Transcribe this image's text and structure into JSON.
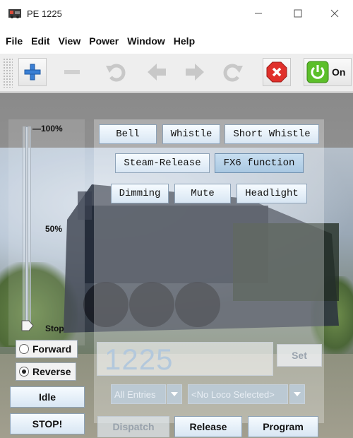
{
  "window": {
    "title": "PE 1225",
    "icons": [
      "locomotive-icon",
      "minimize-icon",
      "maximize-icon",
      "close-icon"
    ]
  },
  "menu": [
    "File",
    "Edit",
    "View",
    "Power",
    "Window",
    "Help"
  ],
  "toolbar": {
    "buttons": [
      "add-icon",
      "remove-icon",
      "undo-icon",
      "back-icon",
      "forward-icon",
      "redo-icon",
      "stop-icon",
      "power-on-icon"
    ],
    "power_label": "On"
  },
  "functions": {
    "row1": [
      "Bell",
      "Whistle",
      "Short Whistle"
    ],
    "row2": [
      "Steam-Release",
      "FX6 function"
    ],
    "row3": [
      "Dimming",
      "Mute",
      "Headlight"
    ],
    "active": [
      "FX6 function"
    ]
  },
  "speed": {
    "max_label": "100%",
    "mid_label": "50%",
    "stop_label": "Stop",
    "value_percent": 0
  },
  "direction": {
    "forward_label": "Forward",
    "reverse_label": "Reverse",
    "selected": "Reverse"
  },
  "controls": {
    "idle_label": "Idle",
    "stop_label": "STOP!"
  },
  "address": {
    "value": "1225",
    "set_label": "Set"
  },
  "selectors": {
    "roster_filter": "All Entries",
    "loco": "<No Loco Selected>"
  },
  "bottom": {
    "dispatch_label": "Dispatch",
    "release_label": "Release",
    "program_label": "Program"
  },
  "colors": {
    "stop_red": "#e0302b",
    "power_green": "#5cbf2a",
    "add_blue": "#3a7fd4"
  }
}
